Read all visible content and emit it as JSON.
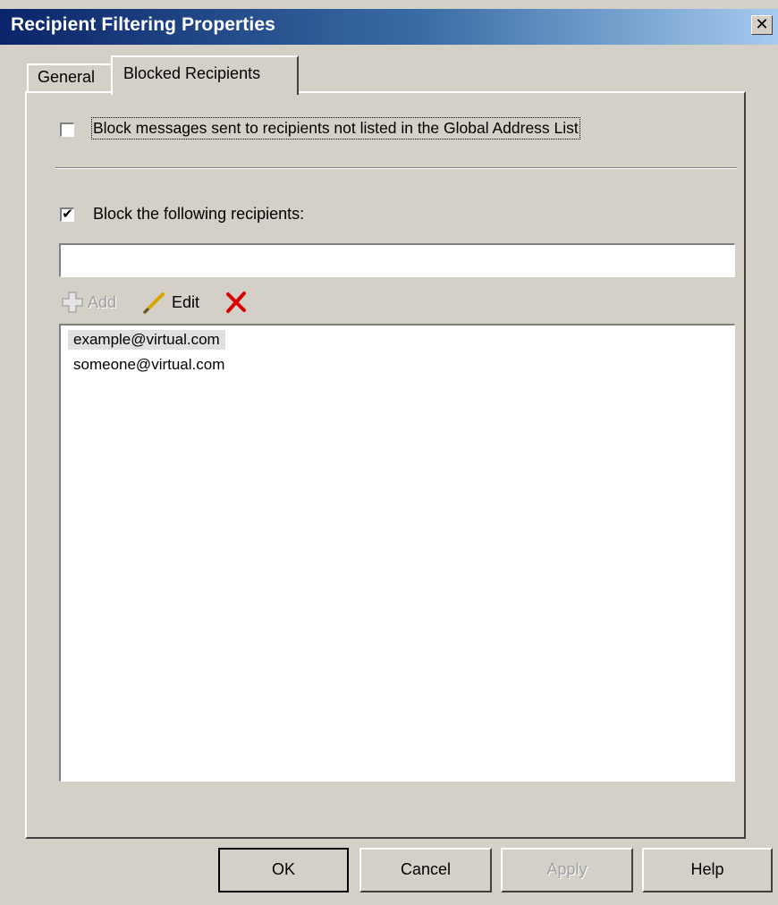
{
  "window": {
    "title": "Recipient Filtering Properties",
    "close_label": "✕"
  },
  "tabs": [
    {
      "label": "General",
      "active": false
    },
    {
      "label": "Blocked Recipients",
      "active": true
    }
  ],
  "options": {
    "block_not_in_gal": {
      "label": "Block messages sent to recipients not listed in the Global Address List",
      "checked": false
    },
    "block_following": {
      "label": "Block the following recipients:",
      "checked": true
    }
  },
  "recipient_input": {
    "value": ""
  },
  "toolbar": {
    "add_label": "Add",
    "add_enabled": false,
    "edit_label": "Edit",
    "delete_icon": "red-x-icon"
  },
  "recipients": [
    {
      "address": "example@virtual.com",
      "selected": true
    },
    {
      "address": "someone@virtual.com",
      "selected": false
    }
  ],
  "buttons": {
    "ok": "OK",
    "cancel": "Cancel",
    "apply": "Apply",
    "help": "Help"
  },
  "colors": {
    "title_gradient_start": "#0a246a",
    "dialog_face": "#d4d0c8",
    "delete_icon": "#d80000"
  }
}
